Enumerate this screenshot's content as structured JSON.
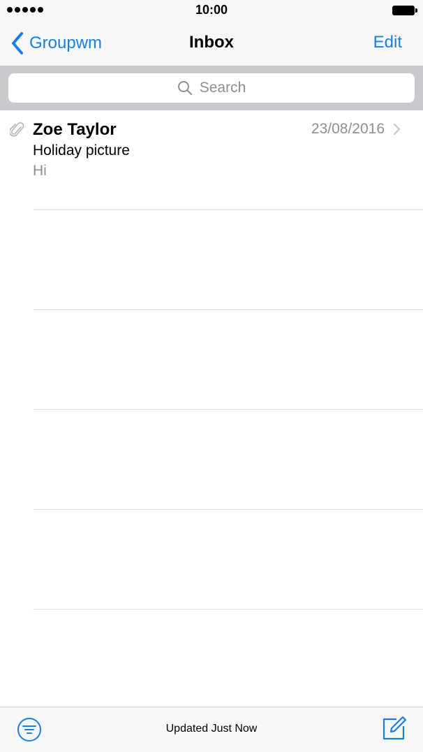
{
  "status_bar": {
    "time": "10:00"
  },
  "nav": {
    "back_label": "Groupwm",
    "title": "Inbox",
    "edit_label": "Edit"
  },
  "search": {
    "placeholder": "Search"
  },
  "messages": [
    {
      "sender": "Zoe Taylor",
      "date": "23/08/2016",
      "subject": "Holiday picture",
      "preview": "Hi",
      "has_attachment": true
    }
  ],
  "toolbar": {
    "status": "Updated Just Now"
  },
  "icons": {
    "back": "chevron-left-icon",
    "search": "magnifier-icon",
    "attachment": "paperclip-icon",
    "disclosure": "chevron-right-icon",
    "filter": "filter-icon",
    "compose": "compose-icon"
  },
  "colors": {
    "accent": "#1a7ee0",
    "secondary_text": "#8e8e93",
    "bar_background": "#f7f7f7",
    "search_background": "#c9c9ce"
  }
}
